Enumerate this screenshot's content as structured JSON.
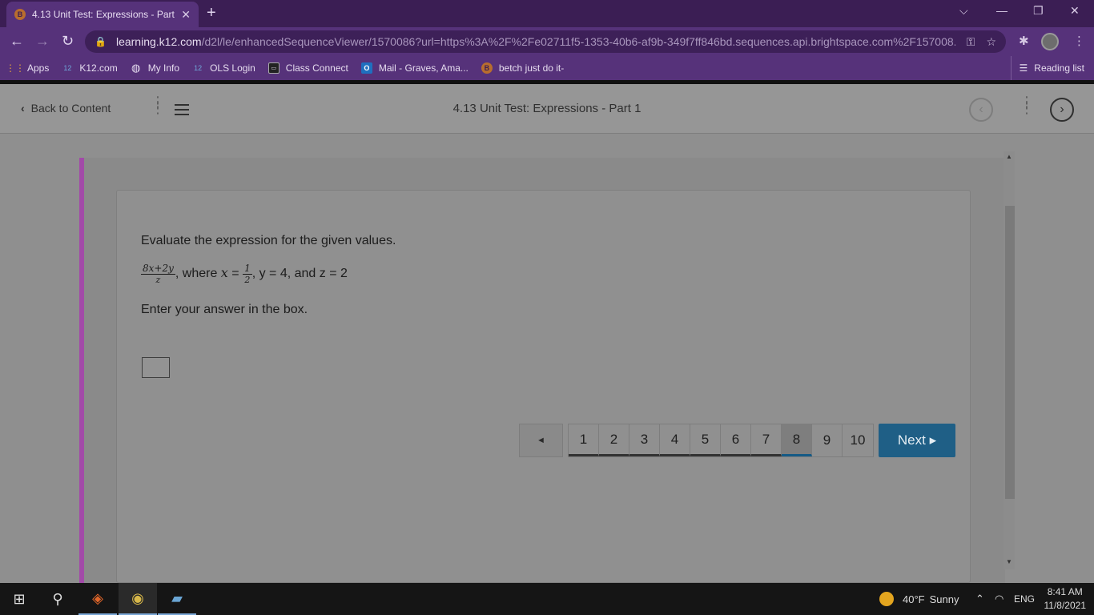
{
  "browser": {
    "tab_title": "4.13 Unit Test: Expressions - Part",
    "tab_favicon": "B",
    "new_tab": "+",
    "url_host": "learning.k12.com",
    "url_rest": "/d2l/le/enhancedSequenceViewer/1570086?url=https%3A%2F%2Fe02711f5-1353-40b6-af9b-349f7ff846bd.sequences.api.brightspace.com%2F157008...",
    "colors": {
      "frame": "#3b1e54",
      "toolbar": "#56327a"
    }
  },
  "bookmarks": [
    {
      "label": "Apps",
      "icon": "apps-grid-icon"
    },
    {
      "label": "K12.com",
      "icon": "k12-icon",
      "badge": "12"
    },
    {
      "label": "My Info",
      "icon": "globe-icon"
    },
    {
      "label": "OLS Login",
      "icon": "k12-icon",
      "badge": "12"
    },
    {
      "label": "Class Connect",
      "icon": "video-icon"
    },
    {
      "label": "Mail - Graves, Ama...",
      "icon": "outlook-icon",
      "badge": "O"
    },
    {
      "label": "betch just do it-",
      "icon": "brave-icon",
      "badge": "B"
    }
  ],
  "reading_list": "Reading list",
  "topbar": {
    "back_label": "Back to Content",
    "title": "4.13 Unit Test: Expressions - Part 1"
  },
  "question": {
    "prompt": "Evaluate the expression for the given values.",
    "frac_num": "8x+2y",
    "frac_den": "z",
    "where": ", where",
    "x_var": "x",
    "equals": "=",
    "x_num": "1",
    "x_den": "2",
    "rest": ", y = 4, and z = 2",
    "instruction": "Enter your answer in the box.",
    "answer_value": ""
  },
  "pager": {
    "prev_symbol": "◄",
    "pages": [
      "1",
      "2",
      "3",
      "4",
      "5",
      "6",
      "7",
      "8",
      "9",
      "10"
    ],
    "current_page": "8",
    "next_label": "Next ▸",
    "colors": {
      "next_bg": "#1f5f86",
      "current_underline": "#155a86"
    }
  },
  "taskbar": {
    "weather_temp": "40°F",
    "weather_desc": "Sunny",
    "lang": "ENG",
    "time": "8:41 AM",
    "date": "11/8/2021"
  }
}
